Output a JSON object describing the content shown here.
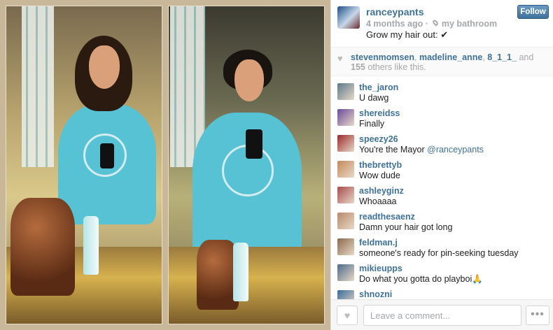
{
  "post": {
    "username": "ranceypants",
    "time_ago": "4 months ago",
    "separator": "·",
    "location": "my bathroom",
    "caption": "Grow my hair out: ✔",
    "follow_label": "Follow"
  },
  "likes": {
    "users": [
      "stevenmomsen",
      "madeline_anne",
      "8_1_1_"
    ],
    "and": "and",
    "count": "155",
    "rest": "others like this."
  },
  "comments": [
    {
      "user": "the_jaron",
      "text": "U dawg",
      "avatar_color": "#5a7a8a"
    },
    {
      "user": "shereidss",
      "text": "Finally",
      "avatar_color": "#6a4a9a"
    },
    {
      "user": "speezy26",
      "text": "You're the Mayor ",
      "mention": "@ranceypants",
      "avatar_color": "#9a2a2a"
    },
    {
      "user": "thebrettyb",
      "text": "Wow dude",
      "avatar_color": "#c48a5a"
    },
    {
      "user": "ashleyginz",
      "text": "Whoaaaa",
      "avatar_color": "#a84a4a"
    },
    {
      "user": "readthesaenz",
      "text": "Damn your hair got long",
      "avatar_color": "#b88a6a"
    },
    {
      "user": "feldman.j",
      "text": "someone's ready for pin-seeking tuesday",
      "avatar_color": "#8a6a4a"
    },
    {
      "user": "mikieupps",
      "text": "Do what you gotta do playboi🙏",
      "avatar_color": "#4a6a8a"
    },
    {
      "user": "shnozni",
      "text": "",
      "avatar_color": "#3a6a9a"
    }
  ],
  "footer": {
    "comment_placeholder": "Leave a comment...",
    "more_label": "•••"
  },
  "icons": {
    "heart": "heart-icon",
    "location": "location-pin-icon",
    "more": "ellipsis-icon"
  },
  "colors": {
    "link_blue": "#3f729b",
    "muted_gray": "#a5a7aa",
    "follow_blue": "#4a7fae"
  }
}
